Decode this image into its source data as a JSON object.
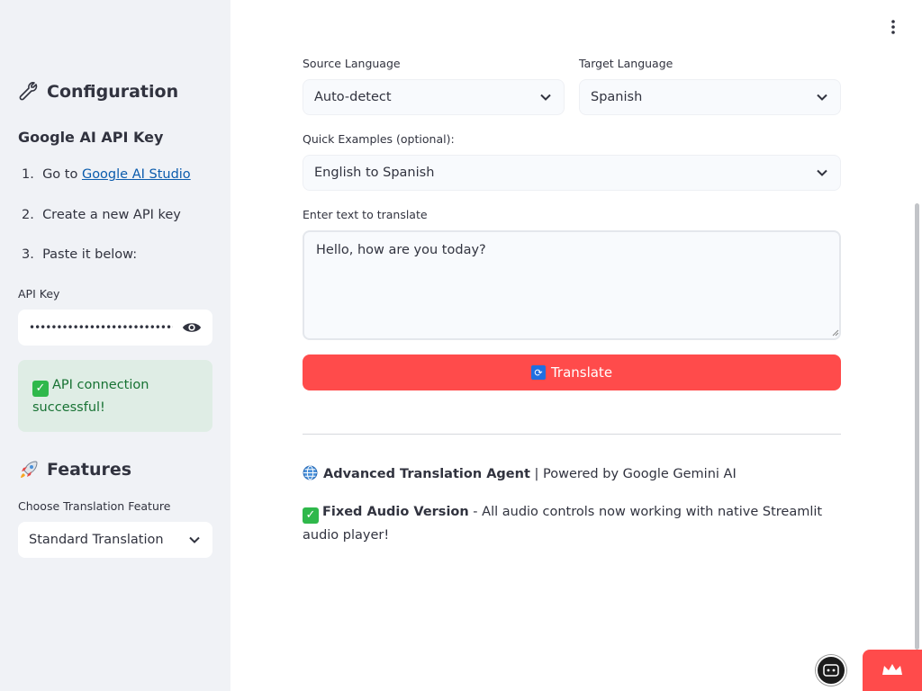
{
  "sidebar": {
    "config_heading": "Configuration",
    "api_subheading": "Google AI API Key",
    "steps": [
      {
        "num": "1.",
        "text": "Go to ",
        "link": "Google AI Studio"
      },
      {
        "num": "2.",
        "text": "Create a new API key"
      },
      {
        "num": "3.",
        "text": "Paste it below:"
      }
    ],
    "api_key_label": "API Key",
    "api_key_value": "•••••••••••••••••••••••••••••••••••••",
    "success_message": "API connection successful!",
    "features_heading": "Features",
    "feature_label": "Choose Translation Feature",
    "feature_value": "Standard Translation"
  },
  "main": {
    "source_label": "Source Language",
    "source_value": "Auto-detect",
    "target_label": "Target Language",
    "target_value": "Spanish",
    "examples_label": "Quick Examples (optional):",
    "examples_value": "English to Spanish",
    "input_label": "Enter text to translate",
    "input_value": "Hello, how are you today?",
    "translate_label": "Translate",
    "footer": {
      "agent_name": "Advanced Translation Agent",
      "powered_by": " | Powered by Google Gemini AI",
      "fixed_title": "Fixed Audio Version",
      "fixed_desc": " - All audio controls now working with native Streamlit audio player!"
    }
  },
  "colors": {
    "primary": "#ff4b4b",
    "sidebar_bg": "#f0f2f6",
    "success_bg": "#dfede5",
    "success_text": "#177233",
    "link": "#0b5cad"
  },
  "icons": [
    "wrench-icon",
    "eye-icon",
    "check-icon",
    "rocket-icon",
    "chevron-down-icon",
    "cycle-icon",
    "globe-icon",
    "kebab-menu-icon",
    "crown-icon"
  ]
}
